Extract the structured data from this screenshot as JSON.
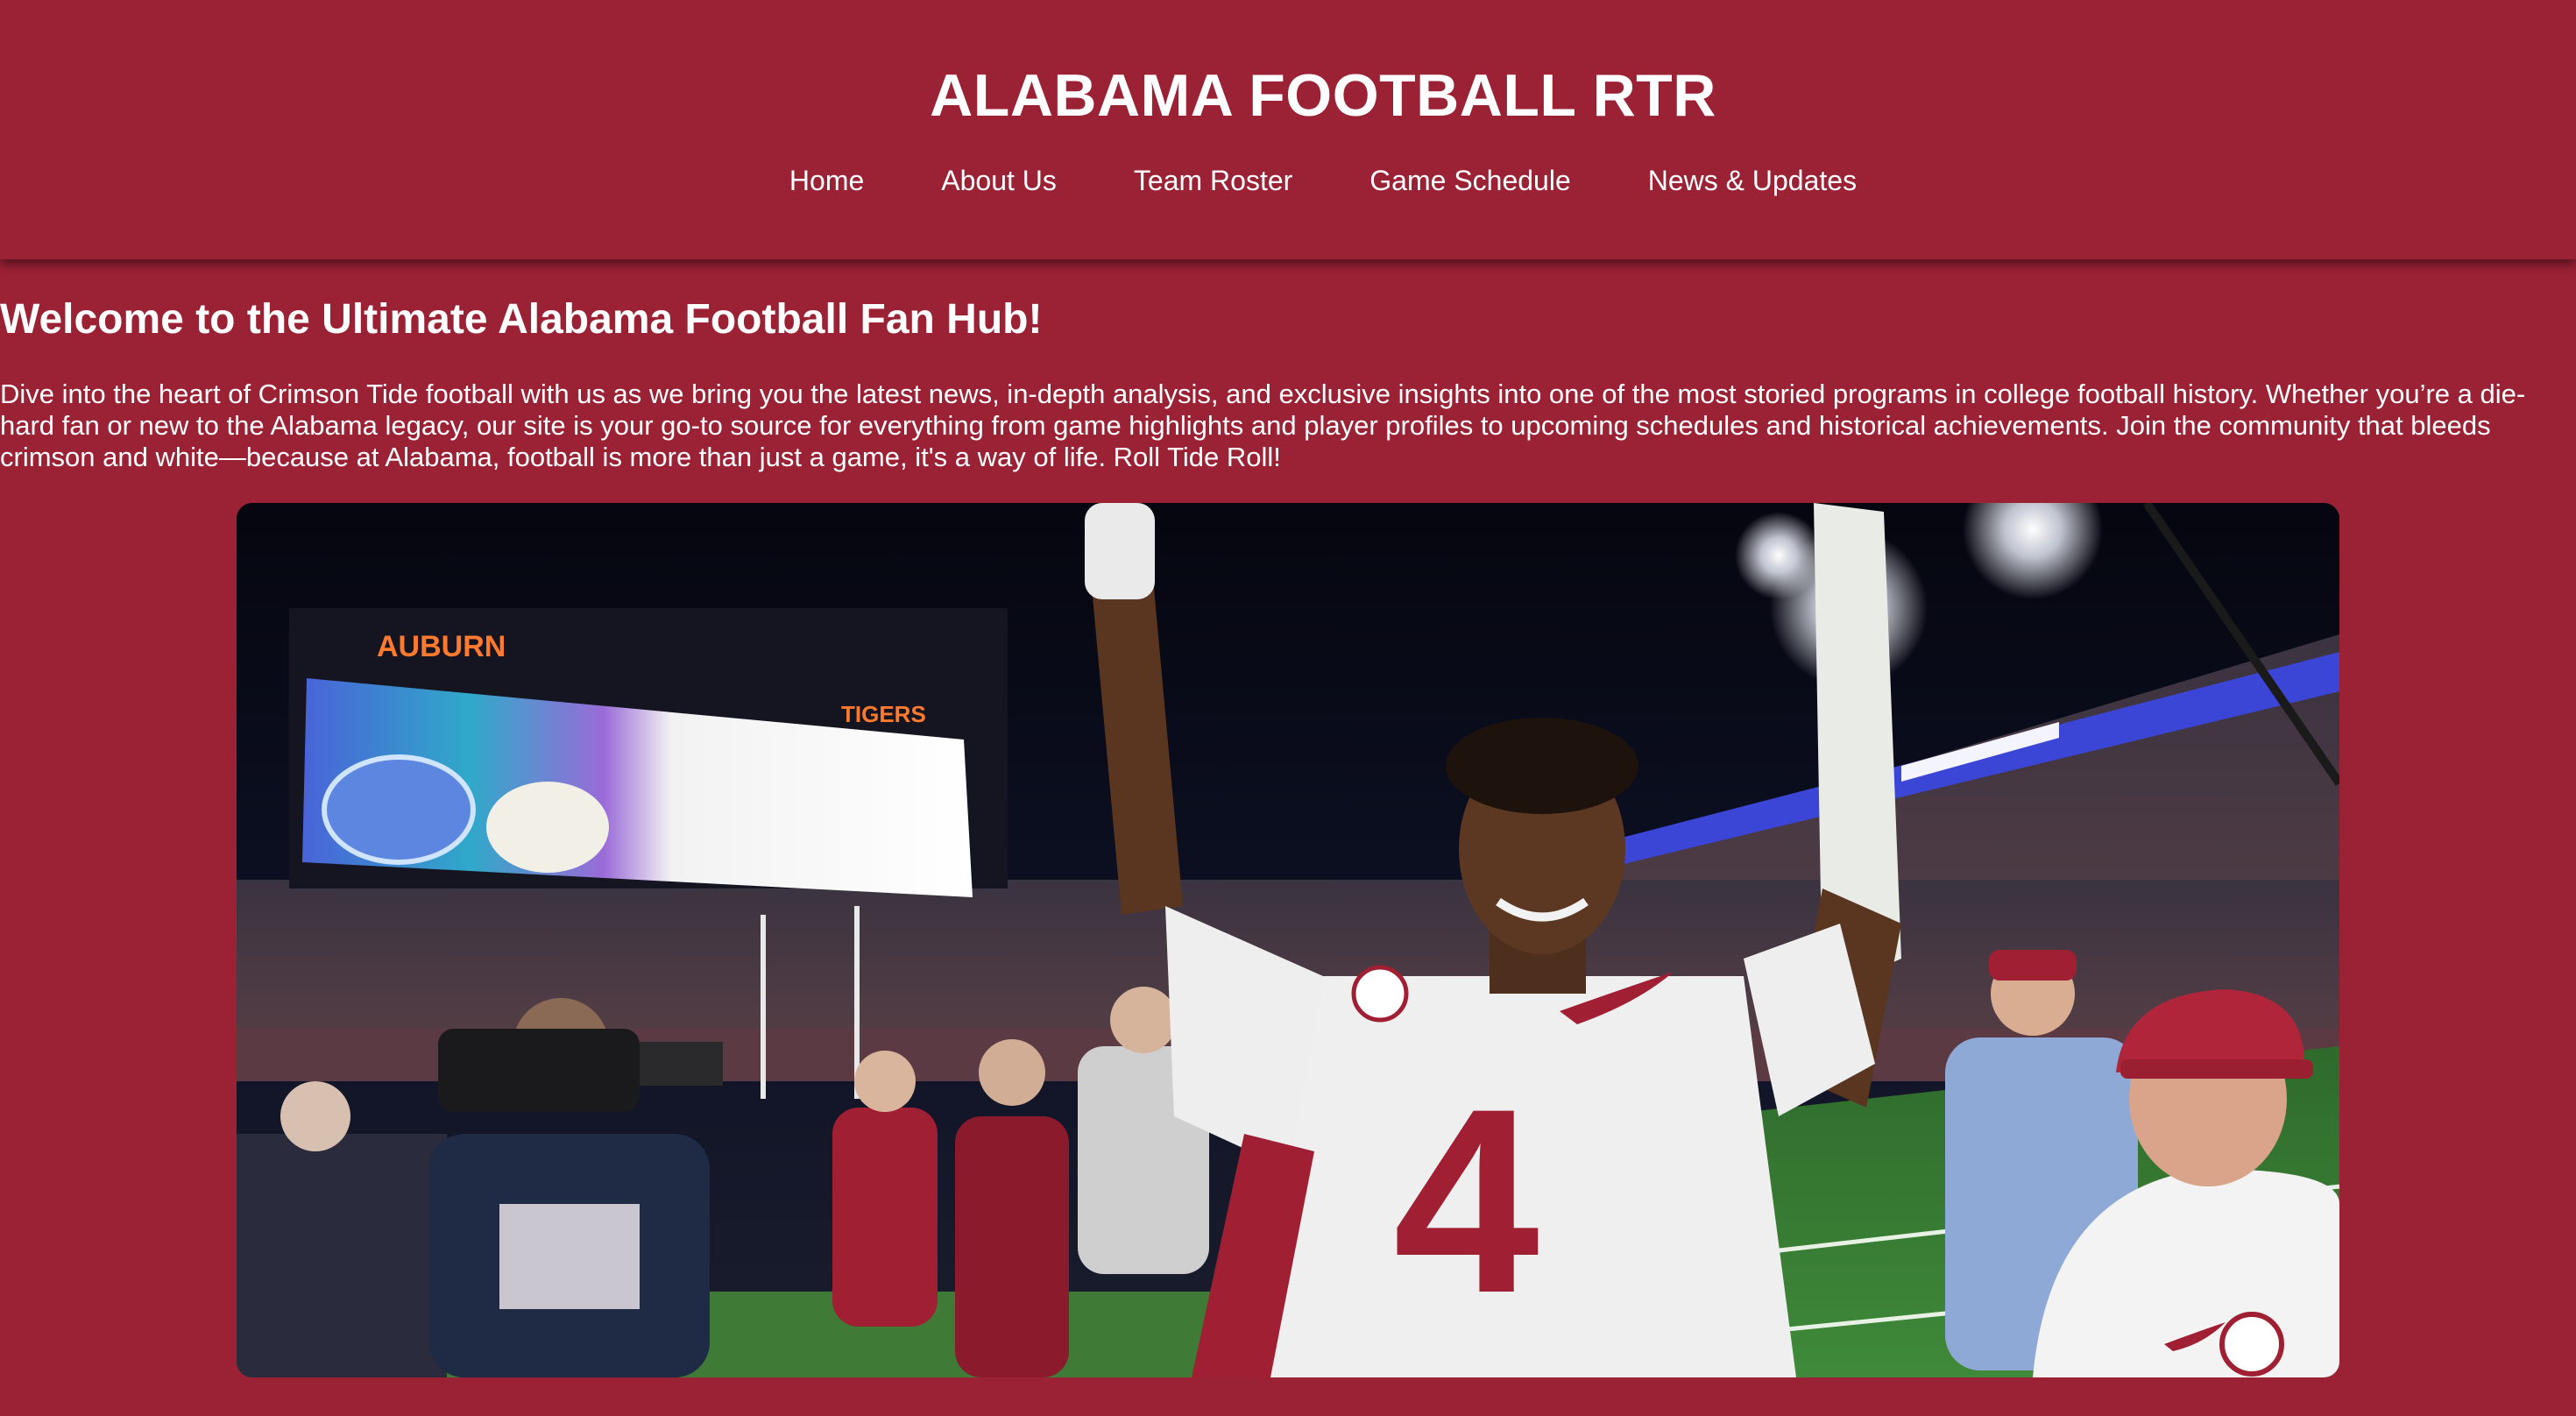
{
  "header": {
    "site_title": "ALABAMA FOOTBALL RTR",
    "nav_items": [
      {
        "label": "Home"
      },
      {
        "label": "About Us"
      },
      {
        "label": "Team Roster"
      },
      {
        "label": "Game Schedule"
      },
      {
        "label": "News & Updates"
      }
    ]
  },
  "main": {
    "welcome_heading": "Welcome to the Ultimate Alabama Football Fan Hub!",
    "intro_text": "Dive into the heart of Crimson Tide football with us as we bring you the latest news, in-depth analysis, and exclusive insights into one of the most storied programs in college football history. Whether you’re a die-hard fan or new to the Alabama legacy, our site is your go-to source for everything from game highlights and player profiles to upcoming schedules and historical achievements. Join the community that bleeds crimson and white—because at Alabama, football is more than just a game, it's a way of life. Roll Tide Roll!",
    "hero_image": {
      "scoreboard_left": "AUBURN",
      "scoreboard_right": "TIGERS",
      "jersey_number": "4"
    }
  },
  "colors": {
    "background": "#9b2135",
    "text": "#ffffff",
    "crimson": "#a01f33"
  }
}
